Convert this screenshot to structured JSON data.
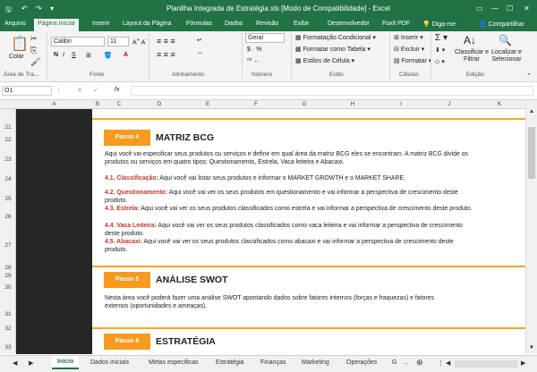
{
  "titlebar": {
    "title": "Planilha Integrada de Estratégia.xls [Modo de Compatibilidade] - Excel"
  },
  "ribbon_tabs": [
    "Arquivo",
    "Página Inicial",
    "Inserir",
    "Layout da Página",
    "Fórmulas",
    "Dados",
    "Revisão",
    "Exibir",
    "Desenvolvedor",
    "Foxit PDF",
    "Diga-me",
    "Compartilhar"
  ],
  "ribbon": {
    "paste": "Colar",
    "font_name": "Calibri",
    "font_size": "11",
    "number_format": "Geral",
    "cond_format": "Formatação Condicional",
    "format_table": "Formatar como Tabela",
    "cell_styles": "Estilos de Célula",
    "insert": "Inserir",
    "delete": "Excluir",
    "format": "Formatar",
    "sort_filter": "Classificar e Filtrar",
    "find_select": "Localizar e Selecionar",
    "groups": {
      "clipboard": "Área de Tra...",
      "font": "Fonte",
      "alignment": "Alinhamento",
      "number": "Número",
      "style": "Estilo",
      "cells": "Células",
      "editing": "Edição"
    }
  },
  "formula_bar": {
    "name_box": "O1",
    "fx": "fx",
    "value": ""
  },
  "columns": [
    "A",
    "B",
    "C",
    "D",
    "E",
    "F",
    "G",
    "H",
    "I",
    "J",
    "K"
  ],
  "rows": [
    "21",
    "22",
    "23",
    "24",
    "25",
    "26",
    "27",
    "28",
    "29",
    "30",
    "31",
    "32",
    "33"
  ],
  "sections": [
    {
      "step": "Passo 4",
      "heading": "MATRIZ BCG",
      "intro": "Aqui você vai especificar seus produtos ou serviços e definir em qual área da matriz BCG eles se encontram. A matriz BCG divide os produtos ou serviços em quatro tipos: Questionamento, Estrela, Vaca leiteira e Abacaxi.",
      "items": [
        {
          "label": "4.1. Classificação:",
          "text": " Aqui você vai listar seus produtos e informar o MARKET GROWTH e o MARKET SHARE."
        },
        {
          "label": "4.2. Questionamento:",
          "text": " Aqui você vai ver os seus produtos em questionamento e vai informar a perspectiva de crescimento deste produto."
        },
        {
          "label": "4.3. Estrela:",
          "text": " Aqui você vai ver os seus produtos classificados como estrela e vai informar a perspectiva de crescimento deste produto."
        },
        {
          "label": "4.4. Vaca Leiteira:",
          "text": " Aqui você vai ver os seus produtos classificados como vaca leiteira e vai informar a perspectiva de crescimento deste produto."
        },
        {
          "label": "4.5. Abacaxi:",
          "text": " Aqui você vai ver os seus produtos classificados como abacaxi e vai informar a perspectiva de crescimento deste produto."
        }
      ]
    },
    {
      "step": "Passo 5",
      "heading": "ANÁLISE SWOT",
      "intro": "Nesta área você poderá fazer uma análise SWOT apontando dados sobre fatores internos (forças e fraquezas) e fatores externos (oportunidades e ameaças)."
    },
    {
      "step": "Passo 6",
      "heading": "ESTRATÉGIA"
    }
  ],
  "sheet_tabs": [
    "Início",
    "Dados iniciais",
    "Metas especificas",
    "Estratégia",
    "Finanças",
    "Marketing",
    "Operações",
    "G"
  ],
  "colors": {
    "excel_green": "#217346",
    "step_orange": "#f79a1e",
    "red_label": "#c0392b"
  }
}
